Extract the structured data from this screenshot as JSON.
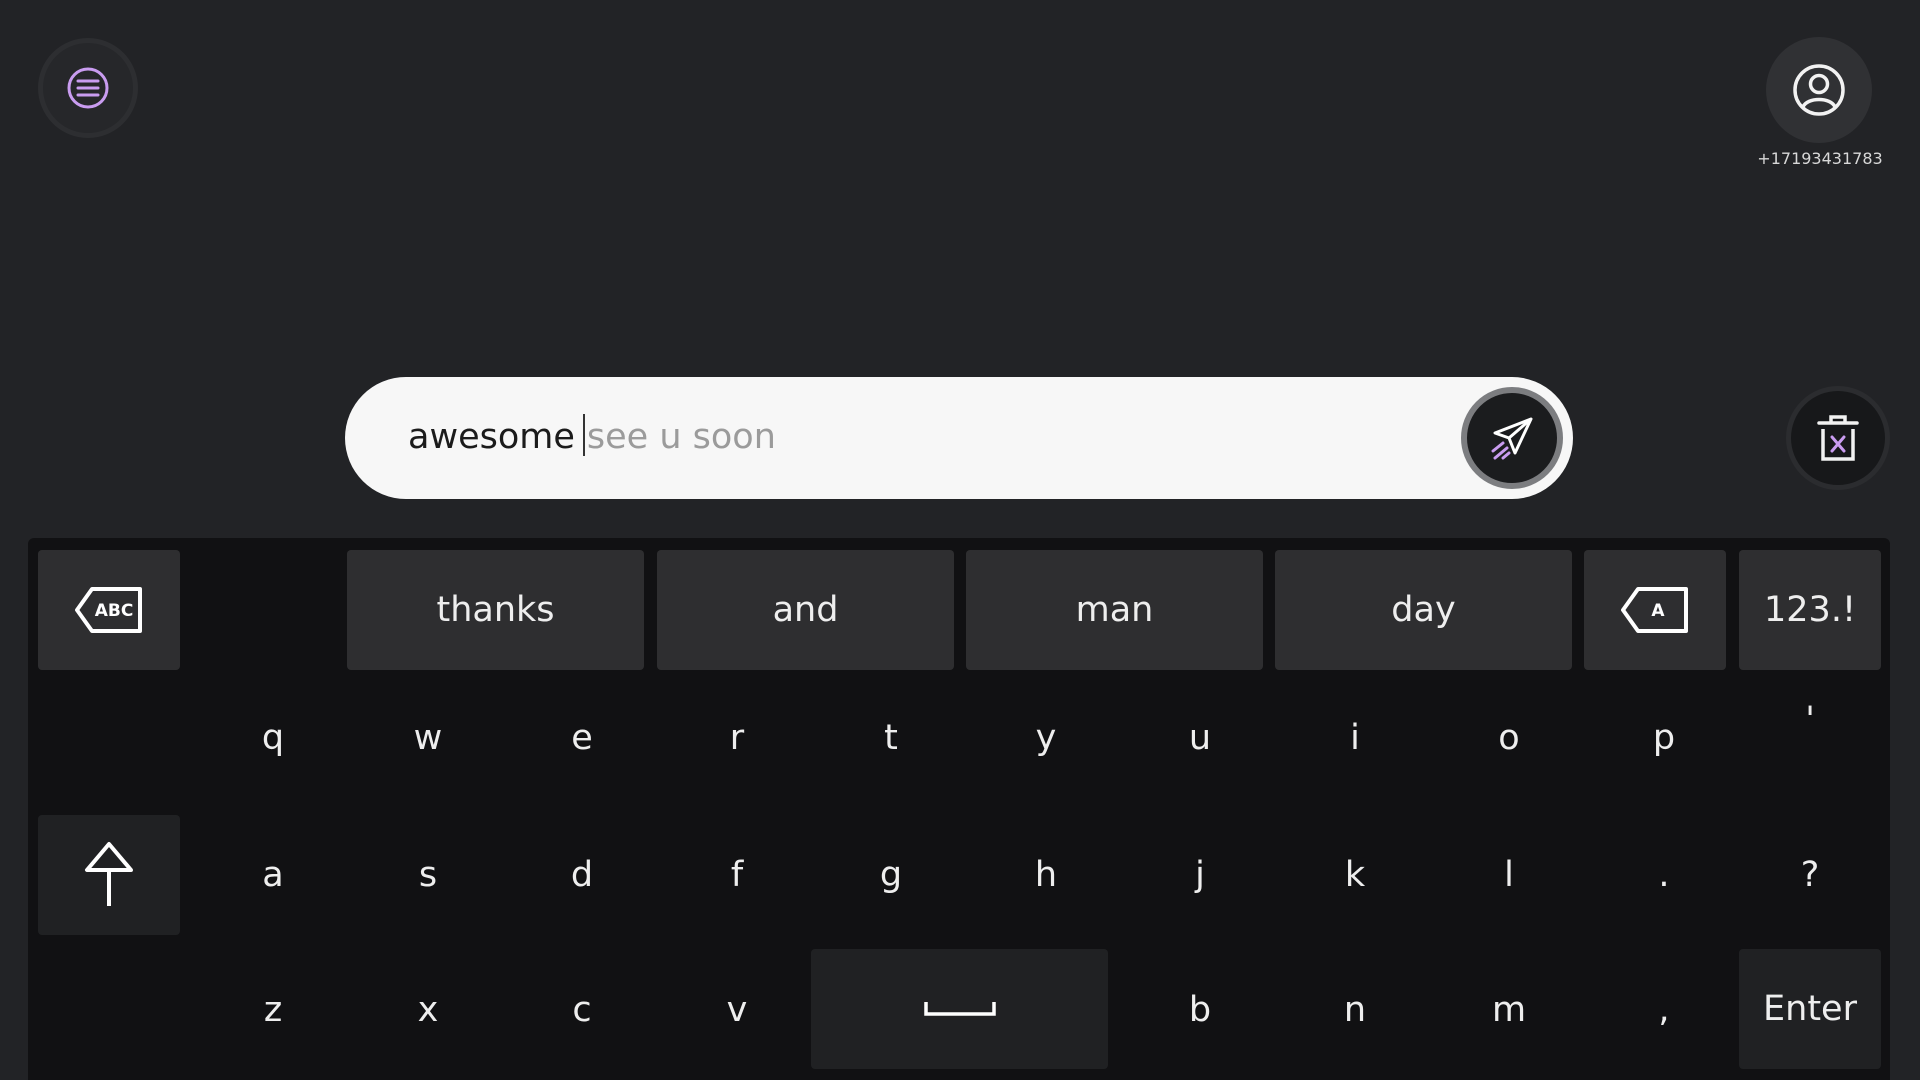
{
  "header": {
    "phone_number": "+17193431783"
  },
  "input": {
    "typed_text": "awesome",
    "suggestion_text": "see u soon"
  },
  "keyboard": {
    "suggestions": [
      "thanks",
      "and",
      "man",
      "day"
    ],
    "numbers_label": "123.!",
    "enter_label": "Enter",
    "rows": [
      [
        "q",
        "w",
        "e",
        "r",
        "t",
        "y",
        "u",
        "i",
        "o",
        "p",
        "'"
      ],
      [
        "a",
        "s",
        "d",
        "f",
        "g",
        "h",
        "j",
        "k",
        "l",
        ".",
        "?"
      ],
      [
        "z",
        "x",
        "c",
        "v",
        "b",
        "n",
        "m",
        ","
      ]
    ],
    "space_glyph": "␣"
  },
  "colors": {
    "background": "#222326",
    "keyboard": "#111113",
    "accent": "#c99cf0",
    "input": "#f7f7f7"
  },
  "icons": [
    "menu-icon",
    "profile-icon",
    "send-icon",
    "delete-icon",
    "backspace-word-icon",
    "backspace-char-icon",
    "shift-icon"
  ]
}
